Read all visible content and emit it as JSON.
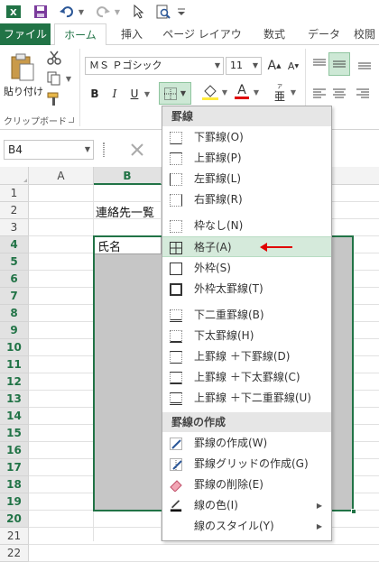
{
  "quick_access": {
    "excel_icon": "excel-icon",
    "save_icon": "save-icon",
    "undo_icon": "undo-icon",
    "redo_icon": "redo-icon",
    "pointer_icon": "pointer-icon",
    "preview_icon": "print-preview-icon"
  },
  "tabs": [
    {
      "label": "ファイル"
    },
    {
      "label": "ホーム"
    },
    {
      "label": "挿入"
    },
    {
      "label": "ページ レイアウト"
    },
    {
      "label": "数式"
    },
    {
      "label": "データ"
    },
    {
      "label": "校閲"
    }
  ],
  "ribbon": {
    "paste_label": "貼り付け",
    "clipboard_group": "クリップボード",
    "font_name": "ＭＳ Ｐゴシック",
    "font_size": "11",
    "bold": "B",
    "italic": "I",
    "underline": "U",
    "font_color_letter": "A",
    "wrap_symbol": "亜"
  },
  "formula_bar": {
    "name_box": "B4"
  },
  "columns": [
    "A",
    "B"
  ],
  "rows": [
    "1",
    "2",
    "3",
    "4",
    "5",
    "6",
    "7",
    "8",
    "9",
    "10",
    "11",
    "12",
    "13",
    "14",
    "15",
    "16",
    "17",
    "18",
    "19",
    "20",
    "21",
    "22"
  ],
  "cells": {
    "b2": "連絡先一覧",
    "b4": "氏名"
  },
  "menu": {
    "header_borders": "罫線",
    "items": [
      {
        "label": "下罫線(O)"
      },
      {
        "label": "上罫線(P)"
      },
      {
        "label": "左罫線(L)"
      },
      {
        "label": "右罫線(R)"
      },
      {
        "label": "枠なし(N)"
      },
      {
        "label": "格子(A)"
      },
      {
        "label": "外枠(S)"
      },
      {
        "label": "外枠太罫線(T)"
      },
      {
        "label": "下二重罫線(B)"
      },
      {
        "label": "下太罫線(H)"
      },
      {
        "label": "上罫線 ＋下罫線(D)"
      },
      {
        "label": "上罫線 ＋下太罫線(C)"
      },
      {
        "label": "上罫線 ＋下二重罫線(U)"
      }
    ],
    "header_create": "罫線の作成",
    "create_items": [
      {
        "label": "罫線の作成(W)"
      },
      {
        "label": "罫線グリッドの作成(G)"
      },
      {
        "label": "罫線の削除(E)"
      },
      {
        "label": "線の色(I)"
      },
      {
        "label": "線のスタイル(Y)"
      }
    ]
  },
  "colors": {
    "excel_green": "#217346",
    "highlight": "#d5eadb",
    "selection": "#c6c6c6",
    "arrow": "#e00000"
  }
}
